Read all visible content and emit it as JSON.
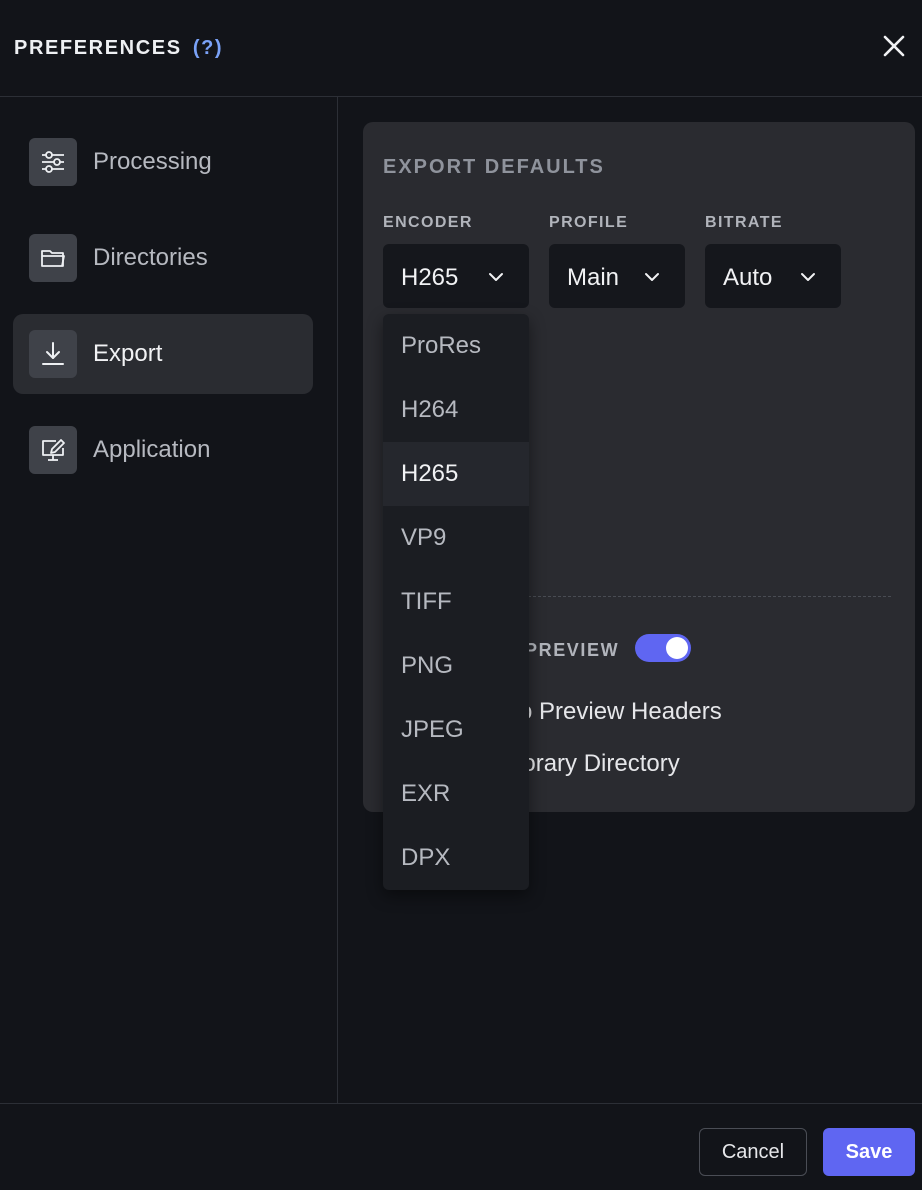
{
  "header": {
    "title": "PREFERENCES",
    "help": "(?)"
  },
  "sidebar": {
    "items": [
      {
        "label": "Processing",
        "icon": "sliders-icon"
      },
      {
        "label": "Directories",
        "icon": "folder-icon"
      },
      {
        "label": "Export",
        "icon": "download-icon",
        "active": true
      },
      {
        "label": "Application",
        "icon": "monitor-edit-icon"
      }
    ]
  },
  "panel": {
    "heading": "EXPORT DEFAULTS",
    "encoder": {
      "label": "ENCODER",
      "value": "H265"
    },
    "profile": {
      "label": "PROFILE",
      "value": "Main"
    },
    "bitrate": {
      "label": "BITRATE",
      "value": "Auto"
    },
    "preview_label": "PREVIEW",
    "preview_enabled": true,
    "option_1": "o Preview Headers",
    "option_2": "porary Directory"
  },
  "encoder_dropdown": {
    "options": [
      "ProRes",
      "H264",
      "H265",
      "VP9",
      "TIFF",
      "PNG",
      "JPEG",
      "EXR",
      "DPX"
    ],
    "selected": "H265"
  },
  "footer": {
    "cancel": "Cancel",
    "save": "Save"
  },
  "colors": {
    "accent": "#5f66f2",
    "help": "#7aa2f7",
    "background": "#121419",
    "panel": "#2a2b30"
  }
}
